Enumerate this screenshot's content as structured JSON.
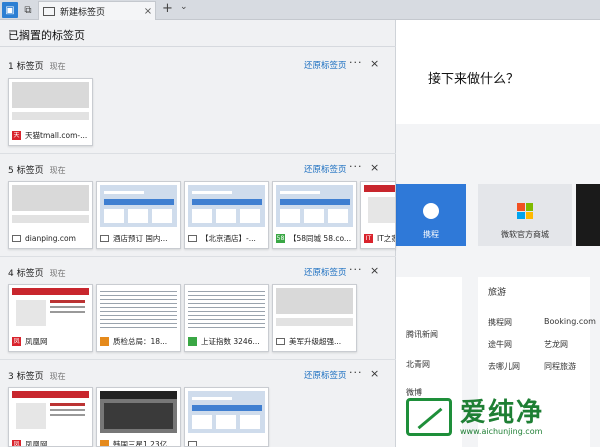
{
  "browser": {
    "tab_title": "新建标签页",
    "tab_close": "×",
    "new_tab": "+",
    "tab_list": "⌄"
  },
  "panel": {
    "title": "已搁置的标签页",
    "restore_label": "还原标签页",
    "more_label": "···",
    "close_label": "×",
    "now_label": "现在",
    "groups": [
      {
        "count_label": "1 标签页",
        "tabs": [
          {
            "caption": "天猫tmall.com-...",
            "icon": "tmall-icon"
          }
        ]
      },
      {
        "count_label": "5 标签页",
        "tabs": [
          {
            "caption": "dianping.com",
            "icon": "page-icon"
          },
          {
            "caption": "酒店预订 国内...",
            "icon": "page-icon"
          },
          {
            "caption": "【北京酒店】-...",
            "icon": "page-icon"
          },
          {
            "caption": "【58同城 58.co...",
            "icon": "58-icon",
            "icon_text": "58"
          },
          {
            "caption": "IT之家",
            "icon": "ithome-icon",
            "icon_text": "IT"
          }
        ]
      },
      {
        "count_label": "4 标签页",
        "tabs": [
          {
            "caption": "凤凰网",
            "icon": "ifeng-icon"
          },
          {
            "caption": "质检总局：18...",
            "icon": "news-icon"
          },
          {
            "caption": "上证指数 3246...",
            "icon": "stock-icon"
          },
          {
            "caption": "美军升级超强...",
            "icon": "page-icon"
          }
        ]
      },
      {
        "count_label": "3 标签页",
        "tabs": [
          {
            "caption": "凤凰网",
            "icon": "ifeng-icon"
          },
          {
            "caption": "韩国三星1.23亿...",
            "icon": "news-icon"
          },
          {
            "caption": "",
            "icon": "page-icon"
          }
        ]
      }
    ]
  },
  "page": {
    "heading": "接下来做什么？",
    "tiles": [
      {
        "label": "携程"
      },
      {
        "label": "微软官方商城"
      }
    ],
    "links_left": [
      "腾讯新闻",
      "北青网",
      "微博"
    ],
    "links_right_header": "旅游",
    "links_right": [
      [
        "携程网",
        "Booking.com"
      ],
      [
        "途牛网",
        "艺龙网"
      ],
      [
        "去哪儿网",
        "同程旅游"
      ]
    ]
  },
  "watermark": {
    "brand": "爱纯净",
    "url": "www.aichunjing.com"
  },
  "colors": {
    "accent": "#1a6ec0",
    "active_tab_button": "#2c7fd3",
    "ctrip_tile": "#2f79d8",
    "watermark_green": "#1e7f34"
  }
}
